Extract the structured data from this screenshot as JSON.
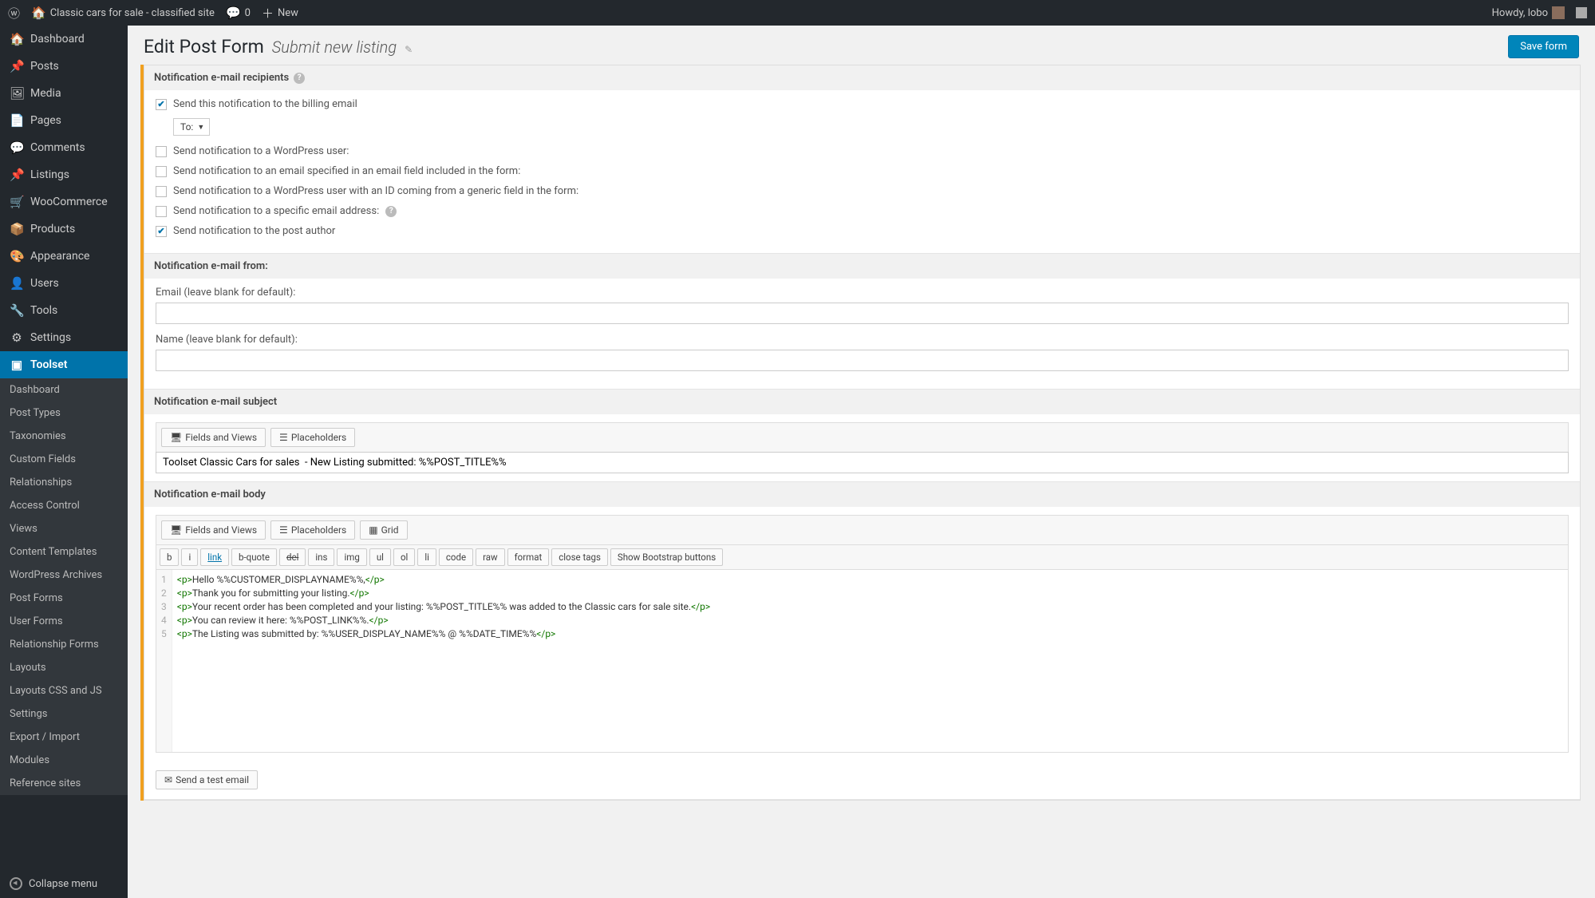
{
  "adminbar": {
    "site_title": "Classic cars for sale - classified site",
    "comments_count": "0",
    "new_label": "New",
    "howdy": "Howdy, lobo"
  },
  "sidebar": {
    "items": [
      {
        "icon": "🏠",
        "label": "Dashboard"
      },
      {
        "icon": "📌",
        "label": "Posts"
      },
      {
        "icon": "🖼",
        "label": "Media"
      },
      {
        "icon": "📄",
        "label": "Pages"
      },
      {
        "icon": "💬",
        "label": "Comments"
      },
      {
        "icon": "📌",
        "label": "Listings"
      },
      {
        "icon": "🛒",
        "label": "WooCommerce"
      },
      {
        "icon": "📦",
        "label": "Products"
      },
      {
        "icon": "🎨",
        "label": "Appearance"
      },
      {
        "icon": "👤",
        "label": "Users"
      },
      {
        "icon": "🔧",
        "label": "Tools"
      },
      {
        "icon": "⚙",
        "label": "Settings"
      }
    ],
    "active": {
      "icon": "▣",
      "label": "Toolset"
    },
    "submenu": [
      "Dashboard",
      "Post Types",
      "Taxonomies",
      "Custom Fields",
      "Relationships",
      "Access Control",
      "Views",
      "Content Templates",
      "WordPress Archives",
      "Post Forms",
      "User Forms",
      "Relationship Forms",
      "Layouts",
      "Layouts CSS and JS",
      "Settings",
      "Export / Import",
      "Modules",
      "Reference sites"
    ],
    "collapse": "Collapse menu"
  },
  "page": {
    "title": "Edit Post Form",
    "subtitle": "Submit new listing",
    "save_button": "Save form"
  },
  "sections": {
    "recipients": {
      "title": "Notification e-mail recipients",
      "cb_billing": "Send this notification to the billing email",
      "to_label": "To:",
      "cb_wp_user": "Send notification to a WordPress user:",
      "cb_email_field": "Send notification to an email specified in an email field included in the form:",
      "cb_wp_id": "Send notification to a WordPress user with an ID coming from a generic field in the form:",
      "cb_specific": "Send notification to a specific email address:",
      "cb_author": "Send notification to the post author"
    },
    "from": {
      "title": "Notification e-mail from:",
      "email_label": "Email (leave blank for default):",
      "name_label": "Name (leave blank for default):"
    },
    "subject": {
      "title": "Notification e-mail subject",
      "fields_views": "Fields and Views",
      "placeholders": "Placeholders",
      "value": "Toolset Classic Cars for sales  - New Listing submitted: %%POST_TITLE%%"
    },
    "body": {
      "title": "Notification e-mail body",
      "fields_views": "Fields and Views",
      "placeholders": "Placeholders",
      "grid": "Grid",
      "quicktags": [
        "b",
        "i",
        "link",
        "b-quote",
        "del",
        "ins",
        "img",
        "ul",
        "ol",
        "li",
        "code",
        "raw",
        "format",
        "close tags",
        "Show Bootstrap buttons"
      ],
      "lines": [
        "<p>Hello %%CUSTOMER_DISPLAYNAME%%,</p>",
        "<p>Thank you for submitting your listing.</p>",
        "<p>Your recent order has been completed and your listing: %%POST_TITLE%% was added to the Classic cars for sale site.</p>",
        "<p>You can review it here: %%POST_LINK%%.</p>",
        "<p>The Listing was submitted by: %%USER_DISPLAY_NAME%% @ %%DATE_TIME%%</p>"
      ],
      "send_test": "Send a test email"
    }
  }
}
